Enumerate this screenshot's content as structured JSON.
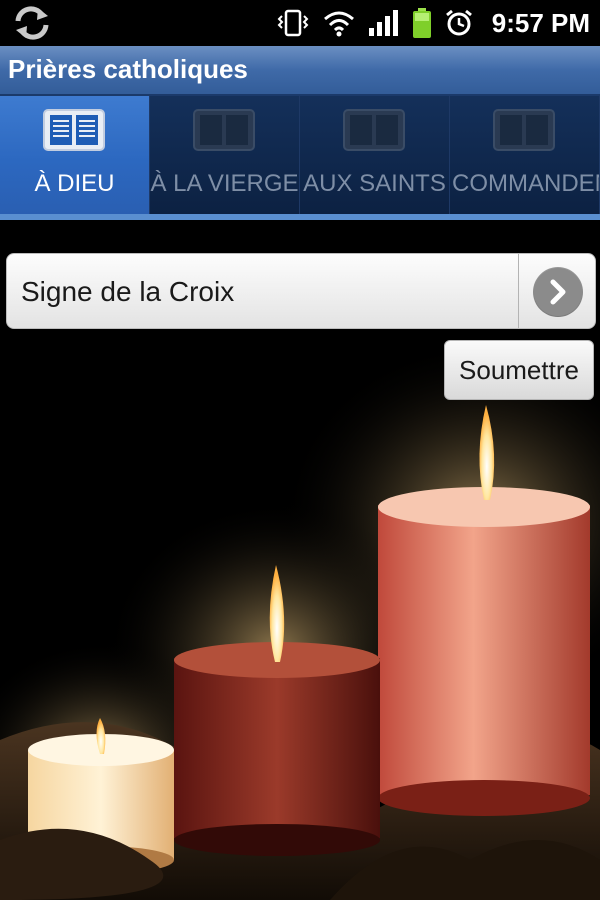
{
  "status_bar": {
    "time": "9:57 PM",
    "icons": [
      "sync-icon",
      "vibrate-icon",
      "wifi-icon",
      "signal-icon",
      "battery-icon",
      "alarm-icon"
    ]
  },
  "app": {
    "title": "Prières catholiques"
  },
  "tabs": [
    {
      "label": "À DIEU",
      "icon": "book-icon",
      "active": true
    },
    {
      "label": "À LA VIERGE",
      "icon": "book-icon",
      "active": false
    },
    {
      "label": "AUX SAINTS",
      "icon": "book-icon",
      "active": false
    },
    {
      "label": "COMMANDEM",
      "icon": "book-icon",
      "active": false
    }
  ],
  "prayer_select": {
    "selected": "Signe de la Croix"
  },
  "submit_button": {
    "label": "Soumettre"
  },
  "colors": {
    "title_bar": "#3f6aa8",
    "tab_active": "#2c68c0",
    "tab_inactive": "#0e2447",
    "tab_accent": "#5a8fd0"
  }
}
